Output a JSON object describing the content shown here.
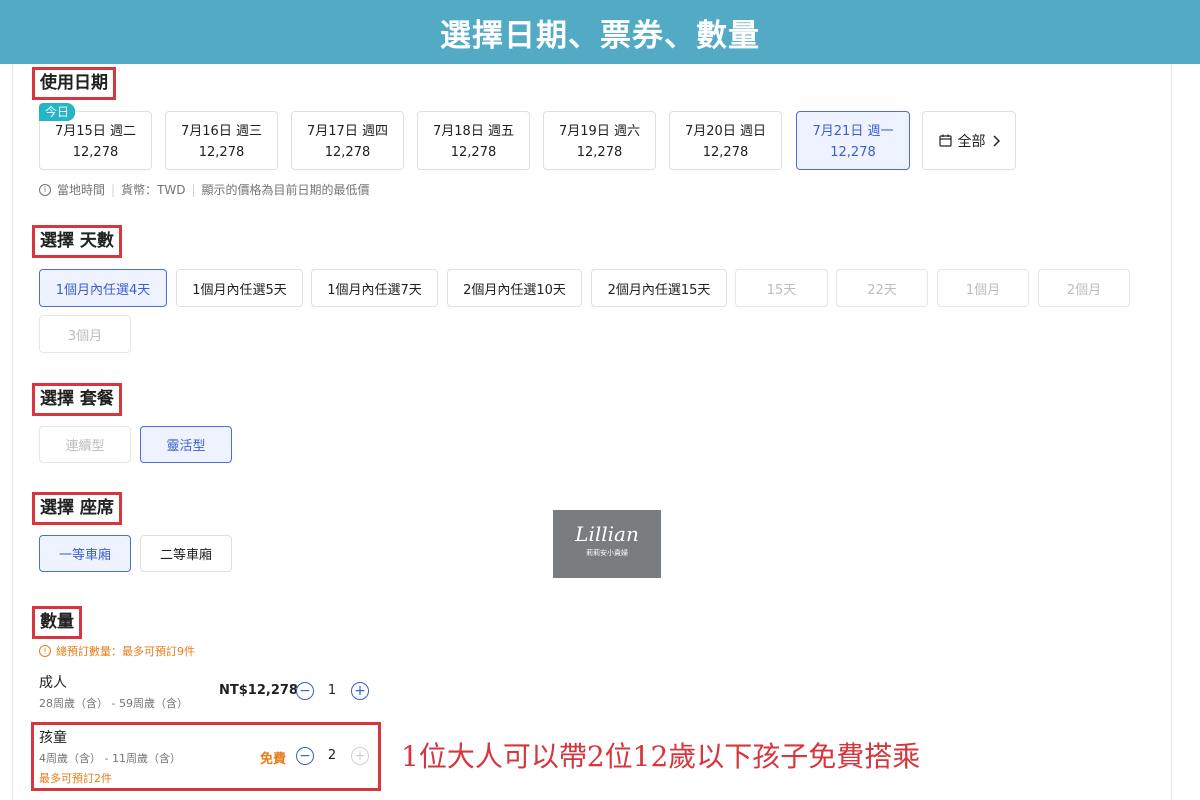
{
  "banner": {
    "title": "選擇日期、票券、數量"
  },
  "usage_date": {
    "title": "使用日期",
    "today_badge": "今日",
    "dates": [
      {
        "date": "7月15日  週二",
        "price": "12,278",
        "selected": false
      },
      {
        "date": "7月16日  週三",
        "price": "12,278",
        "selected": false
      },
      {
        "date": "7月17日  週四",
        "price": "12,278",
        "selected": false
      },
      {
        "date": "7月18日  週五",
        "price": "12,278",
        "selected": false
      },
      {
        "date": "7月19日  週六",
        "price": "12,278",
        "selected": false
      },
      {
        "date": "7月20日  週日",
        "price": "12,278",
        "selected": false
      },
      {
        "date": "7月21日  週一",
        "price": "12,278",
        "selected": true
      }
    ],
    "all_label": "全部",
    "info": [
      "當地時間",
      "貨幣：TWD",
      "顯示的價格為目前日期的最低價"
    ]
  },
  "days": {
    "title": "選擇 天數",
    "options": [
      {
        "label": "1個月內任選4天",
        "state": "selected"
      },
      {
        "label": "1個月內任選5天",
        "state": "normal"
      },
      {
        "label": "1個月內任選7天",
        "state": "normal"
      },
      {
        "label": "2個月內任選10天",
        "state": "normal"
      },
      {
        "label": "2個月內任選15天",
        "state": "normal"
      },
      {
        "label": "15天",
        "state": "disabled"
      },
      {
        "label": "22天",
        "state": "disabled"
      },
      {
        "label": "1個月",
        "state": "disabled"
      },
      {
        "label": "2個月",
        "state": "disabled"
      },
      {
        "label": "3個月",
        "state": "disabled"
      }
    ]
  },
  "package": {
    "title": "選擇 套餐",
    "options": [
      {
        "label": "連續型",
        "state": "disabled"
      },
      {
        "label": "靈活型",
        "state": "selected"
      }
    ]
  },
  "seat": {
    "title": "選擇 座席",
    "options": [
      {
        "label": "一等車廂",
        "state": "selected"
      },
      {
        "label": "二等車廂",
        "state": "normal"
      }
    ]
  },
  "quantity": {
    "title": "數量",
    "notice": "總預訂數量：最多可預訂9件",
    "adult": {
      "label": "成人",
      "age": "28周歲（含） - 59周歲（含）",
      "price": "NT$12,278",
      "count": "1"
    },
    "child": {
      "label": "孩童",
      "age": "4周歲（含） - 11周歲（含）",
      "limit": "最多可預訂2件",
      "price": "免費",
      "count": "2"
    }
  },
  "annotation": "1位大人可以帶2位12歲以下孩子免費搭乘",
  "watermark": {
    "main": "Lillian",
    "sub": "莉莉安小貴婦"
  },
  "colors": {
    "banner": "#52aac4",
    "accent": "#3a5fcf",
    "highlight": "#d6363c",
    "warning": "#e67c1a"
  },
  "icons": {
    "info": "info-icon",
    "calendar": "calendar-icon",
    "chevron": "chevron-right-icon",
    "minus": "minus-icon",
    "plus": "plus-icon",
    "warning": "warning-icon"
  }
}
